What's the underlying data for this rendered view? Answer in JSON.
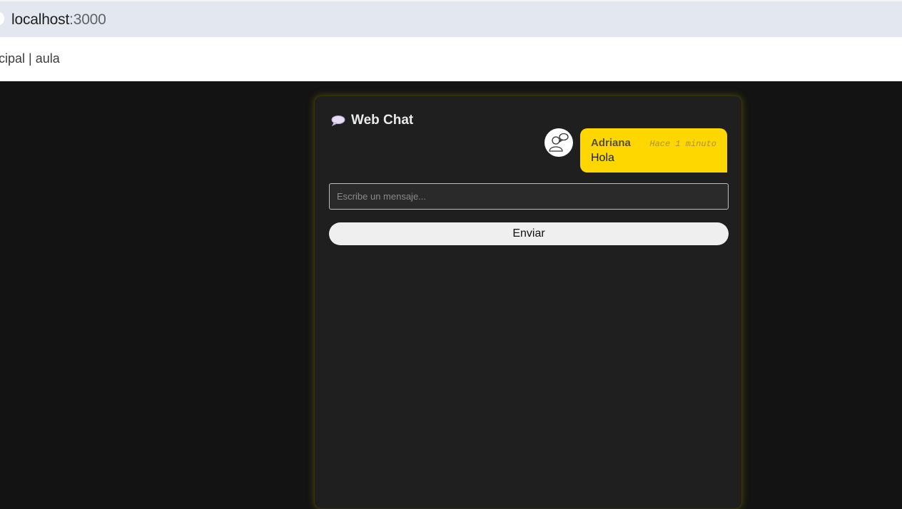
{
  "browser": {
    "url_host": "localhost",
    "url_port": ":3000",
    "tab_fragment": "cipal | aula"
  },
  "chat": {
    "title": "Web Chat",
    "title_icon": "speech-bubble-icon",
    "messages": [
      {
        "author": "Adriana",
        "time": "Hace 1 minuto",
        "text": "Hola",
        "avatar_icon": "user-chat-avatar-icon"
      }
    ],
    "input_placeholder": "Escribe un mensaje...",
    "send_label": "Enviar"
  },
  "colors": {
    "page_background": "#131313",
    "card_background": "#1f1f1f",
    "bubble_accent": "#ffd700",
    "card_glow": "#beaa00"
  }
}
